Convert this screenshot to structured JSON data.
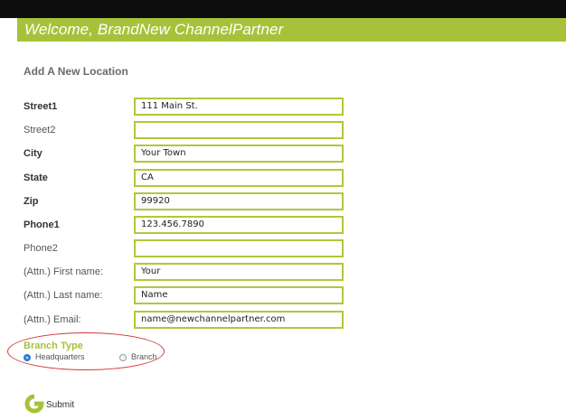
{
  "header": {
    "welcome": "Welcome, BrandNew ChannelPartner"
  },
  "form": {
    "title": "Add A New Location",
    "fields": [
      {
        "label": "Street1",
        "value": "111 Main St.",
        "required": true
      },
      {
        "label": "Street2",
        "value": "",
        "required": false
      },
      {
        "label": "City",
        "value": "Your Town",
        "required": true
      },
      {
        "label": "State",
        "value": "CA",
        "required": true
      },
      {
        "label": "Zip",
        "value": "99920",
        "required": true
      },
      {
        "label": "Phone1",
        "value": "123.456.7890",
        "required": true
      },
      {
        "label": "Phone2",
        "value": "",
        "required": false
      },
      {
        "label": "(Attn.) First name:",
        "value": "Your",
        "required": false
      },
      {
        "label": "(Attn.) Last name:",
        "value": "Name",
        "required": false
      },
      {
        "label": "(Attn.) Email:",
        "value": "name@newchannelpartner.com",
        "required": false
      }
    ],
    "branch_type": {
      "title": "Branch Type",
      "options": [
        {
          "label": "Headquarters",
          "selected": true
        },
        {
          "label": "Branch",
          "selected": false
        }
      ]
    },
    "submit_label": "Submit"
  },
  "colors": {
    "accent": "#a7c23a",
    "field_border": "#b3c63a",
    "annotation": "#d13a36",
    "header_bg": "#0d0d0d"
  }
}
